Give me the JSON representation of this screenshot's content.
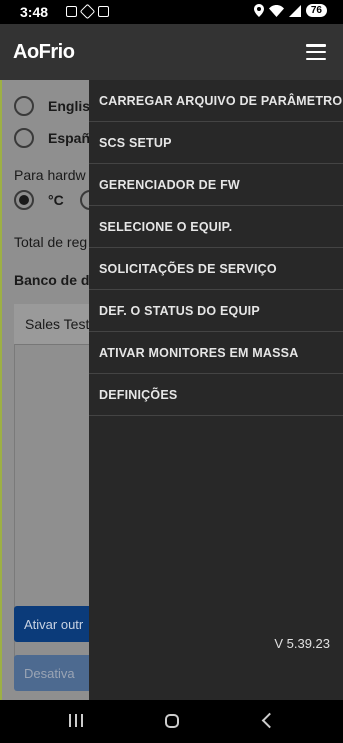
{
  "status_bar": {
    "time": "3:48",
    "battery": "76",
    "icons": [
      "screenshot-icon",
      "vpn-icon",
      "calendar-icon",
      "location-icon",
      "wifi-icon",
      "signal-icon",
      "battery-icon"
    ]
  },
  "header": {
    "logo": "AoFrio",
    "menu_icon": "hamburger-menu-icon"
  },
  "background": {
    "language_english": "Englis",
    "language_spanish": "Españ",
    "hardware_label": "Para hardw",
    "unit_celsius": "°C",
    "total_label": "Total de reg",
    "database_label": "Banco de d",
    "field_value": "Sales Test",
    "activate_button": "Ativar outr",
    "deactivate_button": "Desativa"
  },
  "drawer": {
    "items": [
      {
        "label": "CARREGAR ARQUIVO DE PARÂMETRO"
      },
      {
        "label": "SCS SETUP"
      },
      {
        "label": "GERENCIADOR DE FW"
      },
      {
        "label": "SELECIONE O EQUIP."
      },
      {
        "label": "SOLICITAÇÕES DE SERVIÇO"
      },
      {
        "label": "DEF. O STATUS DO EQUIP"
      },
      {
        "label": "ATIVAR MONITORES EM MASSA"
      },
      {
        "label": "DEFINIÇÕES"
      }
    ],
    "version": "V 5.39.23"
  },
  "colors": {
    "header_bg": "#333333",
    "drawer_bg": "#282828",
    "overlay_content": "#8f8f8f",
    "accent_edge": "#9db044",
    "primary_button": "#0b3b7a"
  }
}
